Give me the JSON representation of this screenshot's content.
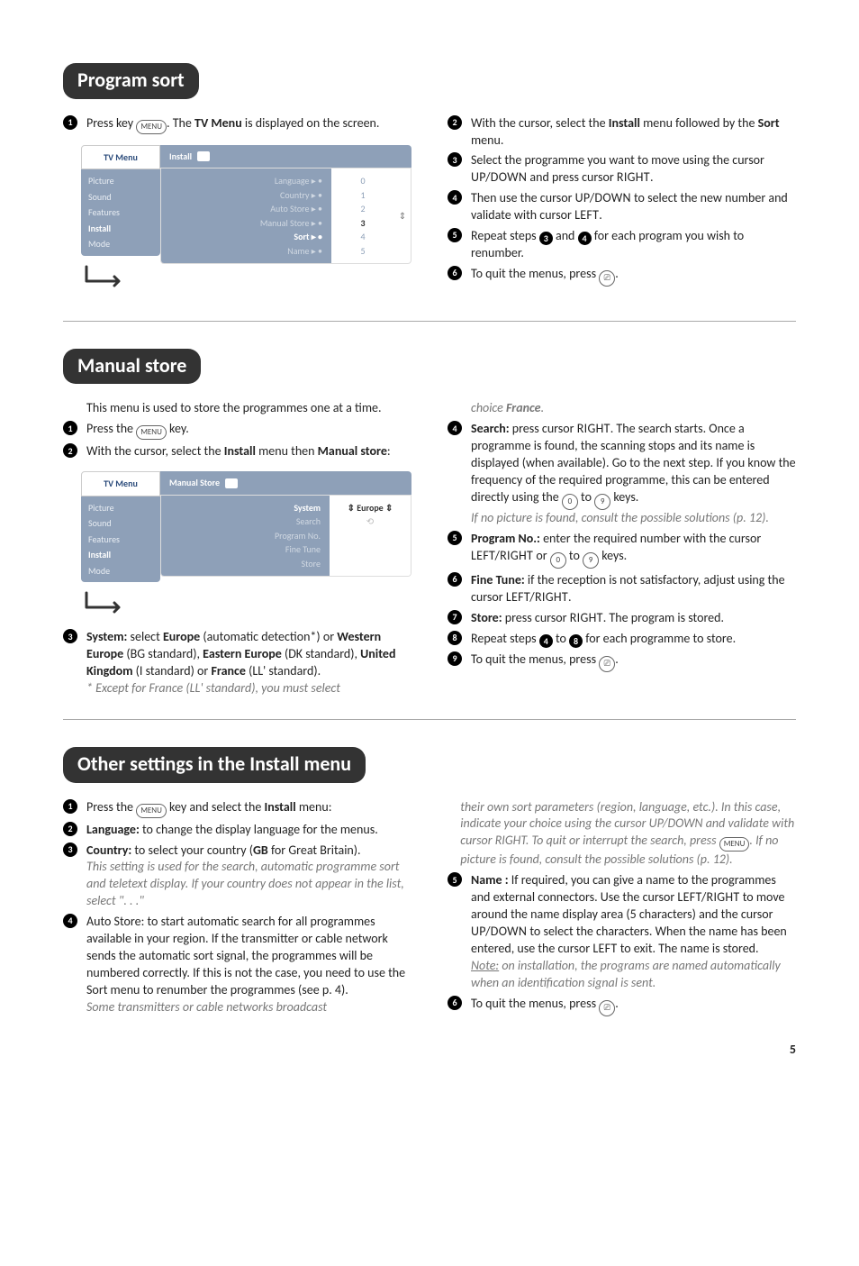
{
  "sections": {
    "program_sort": {
      "title": "Program sort",
      "left": {
        "s1a": "Press key ",
        "s1key": "MENU",
        "s1b": ". The ",
        "s1c": "TV Menu",
        "s1d": " is displayed on the screen."
      },
      "menu": {
        "title": "TV Menu",
        "items": [
          "Picture",
          "Sound",
          "Features",
          "Install",
          "Mode"
        ],
        "active": "Install",
        "head": "Install",
        "colA": [
          "Language ▸  •",
          "Country ▸  •",
          "Auto Store ▸  •",
          "Manual Store ▸  •",
          "Sort ▸  •",
          "Name ▸  •"
        ],
        "colB": [
          "0",
          "1",
          "2",
          "3",
          "4",
          "5"
        ],
        "hlIndex": 3
      },
      "right": {
        "s2a": "With the cursor, select the ",
        "s2b": "Install",
        "s2c": " menu followed by the ",
        "s2d": "Sort",
        "s2e": " menu.",
        "s3": "Select the programme you want to move using the cursor ",
        "s3b": " and press cursor ",
        "s4": "Then use the cursor ",
        "s4b": " to select the new number and validate with cursor ",
        "s5a": "Repeat steps ",
        "s5b": " and ",
        "s5c": " for each program you wish to renumber.",
        "s6": "To quit the menus, press "
      }
    },
    "manual_store": {
      "title": "Manual store",
      "intro": "This menu is used to store the programmes one at a time.",
      "s1a": "Press the ",
      "s1b": " key.",
      "s2a": "With the cursor, select the ",
      "s2b": "Install",
      "s2c": " menu then ",
      "s2d": "Manual store",
      "s2e": ":",
      "menu": {
        "title": "TV Menu",
        "items": [
          "Picture",
          "Sound",
          "Features",
          "Install",
          "Mode"
        ],
        "active": "Install",
        "head": "Manual Store",
        "colA": [
          "System",
          "Search",
          "Program No.",
          "Fine Tune",
          "Store"
        ],
        "colB_hl": "Europe",
        "hlIndex": 0
      },
      "s3a": "System:",
      "s3b": " select ",
      "s3c": "Europe",
      "s3d": " (automatic detection*) or ",
      "s3e": "Western Europe",
      "s3f": " (BG standard), ",
      "s3g": "Eastern Europe",
      "s3h": " (DK standard), ",
      "s3i": "United Kingdom",
      "s3j": " (I standard) or ",
      "s3k": "France",
      "s3l": " (LL' standard).",
      "s3note": "* Except for France (LL' standard), you must select",
      "right": {
        "choice": "choice ",
        "choice_b": "France",
        "s4a": "Search:",
        "s4b": " press cursor ",
        "s4c": ". The search starts. Once a programme is found, the scanning stops and its name is displayed (when available). Go to the next step. If you know the frequency of the required programme, this can be entered directly using the ",
        "s4d": " to ",
        "s4e": " keys.",
        "s4note": "If no picture is found, consult the possible solutions (p. 12).",
        "s5a": "Program No.:",
        "s5b": " enter the required number with the cursor ",
        "s5c": " or ",
        "s5d": " to ",
        "s5e": " keys.",
        "s6a": "Fine Tune:",
        "s6b": " if the reception is not satisfactory, adjust using the cursor ",
        "s7a": "Store:",
        "s7b": " press cursor ",
        "s7c": ". The program is stored.",
        "s8a": "Repeat steps ",
        "s8b": " to ",
        "s8c": " for each programme to store.",
        "s9": "To quit the menus, press "
      }
    },
    "other": {
      "title": "Other settings in the Install menu",
      "s1a": "Press the ",
      "s1b": " key and select the ",
      "s1c": "Install",
      "s1d": " menu:",
      "s2a": "Language:",
      "s2b": " to change the display language for the menus.",
      "s3a": "Country:",
      "s3b": " to select your country (",
      "s3c": "GB",
      "s3d": " for Great Britain).",
      "s3note": "This setting is used for the search, automatic programme sort and teletext display. If your country does not appear in the list, select \". . .\"",
      "s4": "Auto Store: to start automatic search for all programmes available in your region. If the transmitter or cable network sends the automatic sort signal, the programmes will be numbered correctly. If this is not the case, you need to use the Sort menu to renumber the programmes (see p. 4).",
      "s4note": "Some transmitters or cable networks broadcast",
      "right": {
        "cont": "their own sort parameters (region, language, etc.). In this case, indicate your choice using the cursor UP/DOWN and validate with cursor RIGHT. To quit or interrupt the search, press ",
        "cont2": ". If no picture is found, consult the possible solutions (p. 12).",
        "s5a": "Name :",
        "s5b": " If required, you can give a name to the programmes and external connectors. Use the cursor ",
        "s5c": " to move around the name display area (5 characters) and the cursor ",
        "s5d": " to select the characters. When the name has been entered, use the cursor ",
        "s5e": " to exit. The name is stored.",
        "s5note_a": "Note:",
        "s5note_b": " on installation, the programs are named automatically when an identification signal is sent.",
        "s6": "To quit the menus, press "
      }
    }
  },
  "keys": {
    "menu": "MENU",
    "exit": "⎚",
    "zero": "0",
    "nine": "9",
    "updown": "UP/DOWN",
    "right": "RIGHT",
    "left": "LEFT",
    "leftright": "LEFT/RIGHT"
  },
  "page": "5"
}
